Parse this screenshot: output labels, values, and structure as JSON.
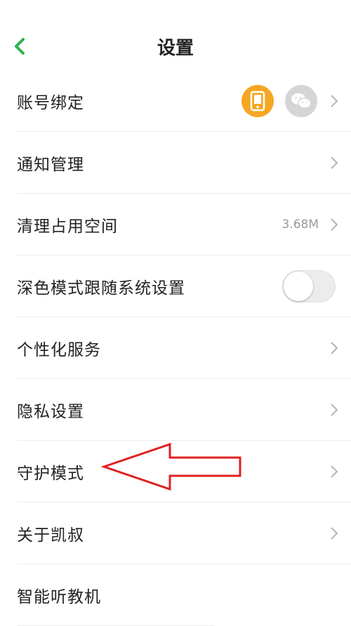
{
  "header": {
    "title": "设置",
    "back_icon": "chevron-left-icon",
    "accent": "#2bb24c"
  },
  "rows": [
    {
      "id": "account-binding",
      "label": "账号绑定",
      "icons": [
        "phone-icon",
        "wechat-icon"
      ]
    },
    {
      "id": "notification",
      "label": "通知管理"
    },
    {
      "id": "storage",
      "label": "清理占用空间",
      "value": "3.68M"
    },
    {
      "id": "dark-mode",
      "label": "深色模式跟随系统设置",
      "toggle": false
    },
    {
      "id": "personalized",
      "label": "个性化服务"
    },
    {
      "id": "privacy",
      "label": "隐私设置"
    },
    {
      "id": "guardian",
      "label": "守护模式"
    },
    {
      "id": "about",
      "label": "关于凯叔"
    },
    {
      "id": "smart-player",
      "label": "智能听教机"
    }
  ],
  "colors": {
    "phone_badge": "#f5a623",
    "wechat_badge": "#d5d5d5",
    "annotation_arrow": "#e02020"
  }
}
